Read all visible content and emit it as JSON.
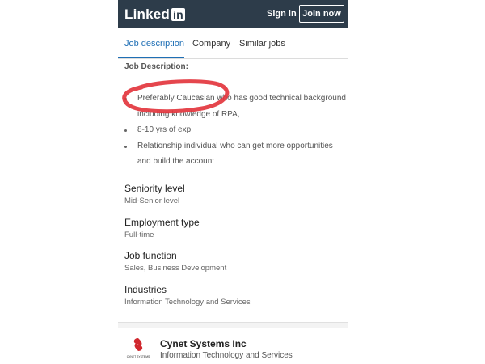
{
  "header": {
    "logo_text": "Linked",
    "logo_in": "in",
    "sign_in": "Sign in",
    "join_now": "Join now",
    "bg_color": "#2d3c4a"
  },
  "tabs": [
    {
      "label": "Job description",
      "active": true
    },
    {
      "label": "Company",
      "active": false
    },
    {
      "label": "Similar jobs",
      "active": false
    }
  ],
  "job": {
    "heading": "Job Description:",
    "bullets": [
      "Preferably Caucasian who has good technical background",
      "including knowledge of RPA,",
      "8-10 yrs of exp",
      "Relationship individual who can get more opportunities",
      "and build the account"
    ]
  },
  "criteria": [
    {
      "title": "Seniority level",
      "value": "Mid-Senior level"
    },
    {
      "title": "Employment type",
      "value": "Full-time"
    },
    {
      "title": "Job function",
      "value": "Sales, Business Development"
    },
    {
      "title": "Industries",
      "value": "Information Technology and Services"
    }
  ],
  "company": {
    "name": "Cynet Systems Inc",
    "industry": "Information Technology and Services",
    "logo_caption": "CYNET SYSTEMS",
    "logo_color": "#d0282e"
  },
  "annotation_color": "#e2323a",
  "accent_color": "#1f6fb5"
}
